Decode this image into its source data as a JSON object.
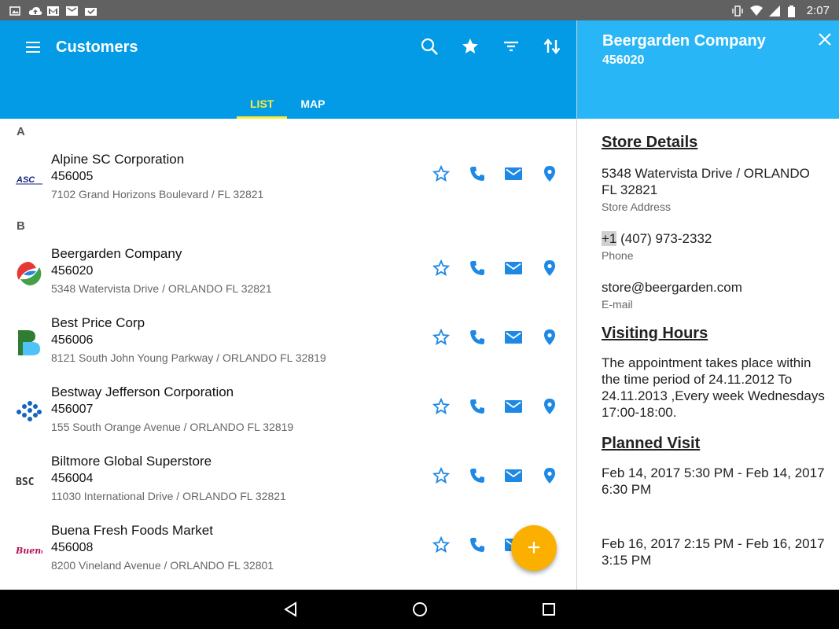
{
  "status_bar": {
    "time": "2:07"
  },
  "app_bar": {
    "title": "Customers",
    "tabs": [
      {
        "label": "LIST",
        "active": true
      },
      {
        "label": "MAP",
        "active": false
      }
    ]
  },
  "list": {
    "sections": [
      {
        "letter": "A",
        "items": [
          {
            "name": "Alpine SC Corporation",
            "id": "456005",
            "address": "7102 Grand Horizons Boulevard / FL 32821",
            "logo_text": "ASC"
          }
        ]
      },
      {
        "letter": "B",
        "items": [
          {
            "name": "Beergarden Company",
            "id": "456020",
            "address": "5348 Watervista Drive / ORLANDO FL 32821"
          },
          {
            "name": "Best Price Corp",
            "id": "456006",
            "address": "8121 South John Young Parkway / ORLANDO FL 32819"
          },
          {
            "name": "Bestway Jefferson Corporation",
            "id": "456007",
            "address": "155 South Orange Avenue / ORLANDO FL 32819"
          },
          {
            "name": "Biltmore Global Superstore",
            "id": "456004",
            "address": "11030 International Drive / ORLANDO FL 32821",
            "logo_text": "BSC"
          },
          {
            "name": "Buena Fresh Foods Market",
            "id": "456008",
            "address": "8200 Vineland Avenue / ORLANDO FL 32801",
            "logo_text": "Buena"
          }
        ]
      }
    ]
  },
  "fab": {
    "label": "+"
  },
  "detail": {
    "name": "Beergarden Company",
    "id": "456020",
    "store_details_heading": "Store Details",
    "address": "5348 Watervista Drive / ORLANDO FL 32821",
    "address_label": "Store Address",
    "phone_prefix": "+1",
    "phone_rest": " (407) 973-2332",
    "phone_label": "Phone",
    "email": "store@beergarden.com",
    "email_label": "E-mail",
    "visiting_hours_heading": "Visiting Hours",
    "visiting_hours_text": "The appointment takes place within the time period of 24.11.2012 To 24.11.2013 ,Every week Wednesdays 17:00-18:00.",
    "planned_visit_heading": "Planned Visit",
    "planned_visits": [
      "Feb 14, 2017 5:30 PM - Feb 14, 2017 6:30 PM",
      "Feb 16, 2017 2:15 PM - Feb 16, 2017 3:15 PM"
    ]
  },
  "colors": {
    "primary": "#039be5",
    "detail_header": "#29b6f6",
    "accent_tab": "#ffeb3b",
    "fab": "#fbb000",
    "action_icon": "#1e88e5"
  }
}
